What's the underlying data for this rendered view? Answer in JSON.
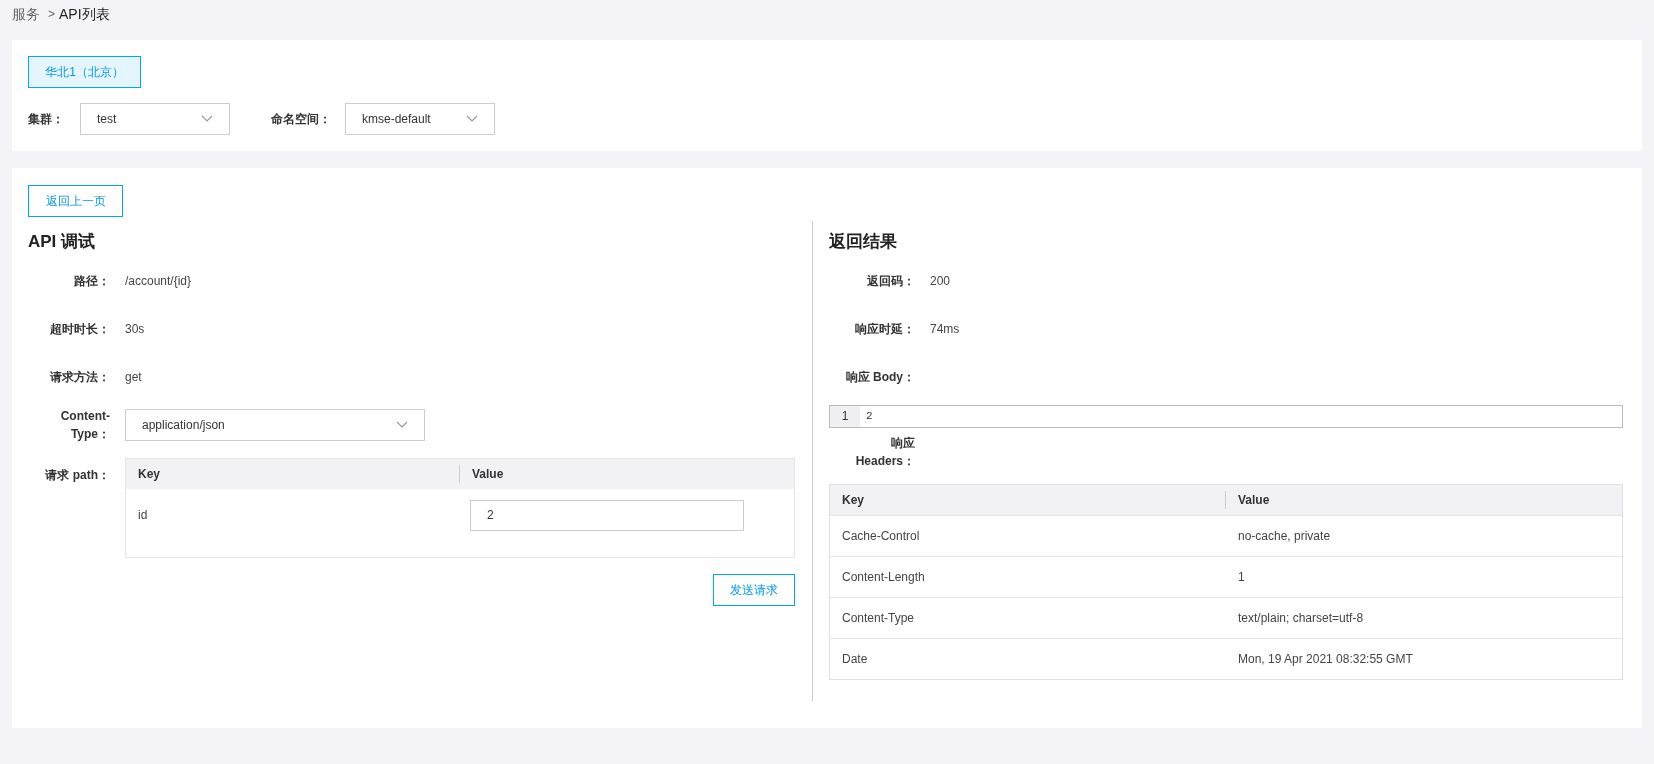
{
  "breadcrumb": {
    "parent": "服务",
    "separator": ">",
    "current": "API列表"
  },
  "region_tabs": [
    {
      "label": "华北1（北京）",
      "selected": true
    }
  ],
  "filters": [
    {
      "label": "集群：",
      "value": "test"
    },
    {
      "label": "命名空间：",
      "value": "kmse-default"
    }
  ],
  "back_button": "返回上一页",
  "debug": {
    "title": "API 调试",
    "fields": [
      {
        "label": "路径：",
        "value": "/account/{id}"
      },
      {
        "label": "超时时长：",
        "value": "30s"
      },
      {
        "label": "请求方法：",
        "value": "get"
      }
    ],
    "content_type": {
      "label": "Content-Type：",
      "value": "application/json"
    },
    "path_params": {
      "label": "请求 path：",
      "columns": [
        "Key",
        "Value"
      ],
      "rows": [
        {
          "key": "id",
          "value": "2"
        }
      ]
    },
    "send_button": "发送请求"
  },
  "result": {
    "title": "返回结果",
    "fields": [
      {
        "label": "返回码：",
        "value": "200"
      },
      {
        "label": "响应时延：",
        "value": "74ms"
      }
    ],
    "body": {
      "label": "响应 Body：",
      "line_number": "1",
      "content": "2"
    },
    "headers": {
      "label": "响应 Headers：",
      "columns": [
        "Key",
        "Value"
      ],
      "rows": [
        {
          "key": "Cache-Control",
          "value": "no-cache, private"
        },
        {
          "key": "Content-Length",
          "value": "1"
        },
        {
          "key": "Content-Type",
          "value": "text/plain; charset=utf-8"
        },
        {
          "key": "Date",
          "value": "Mon, 19 Apr 2021 08:32:55 GMT"
        }
      ]
    }
  }
}
